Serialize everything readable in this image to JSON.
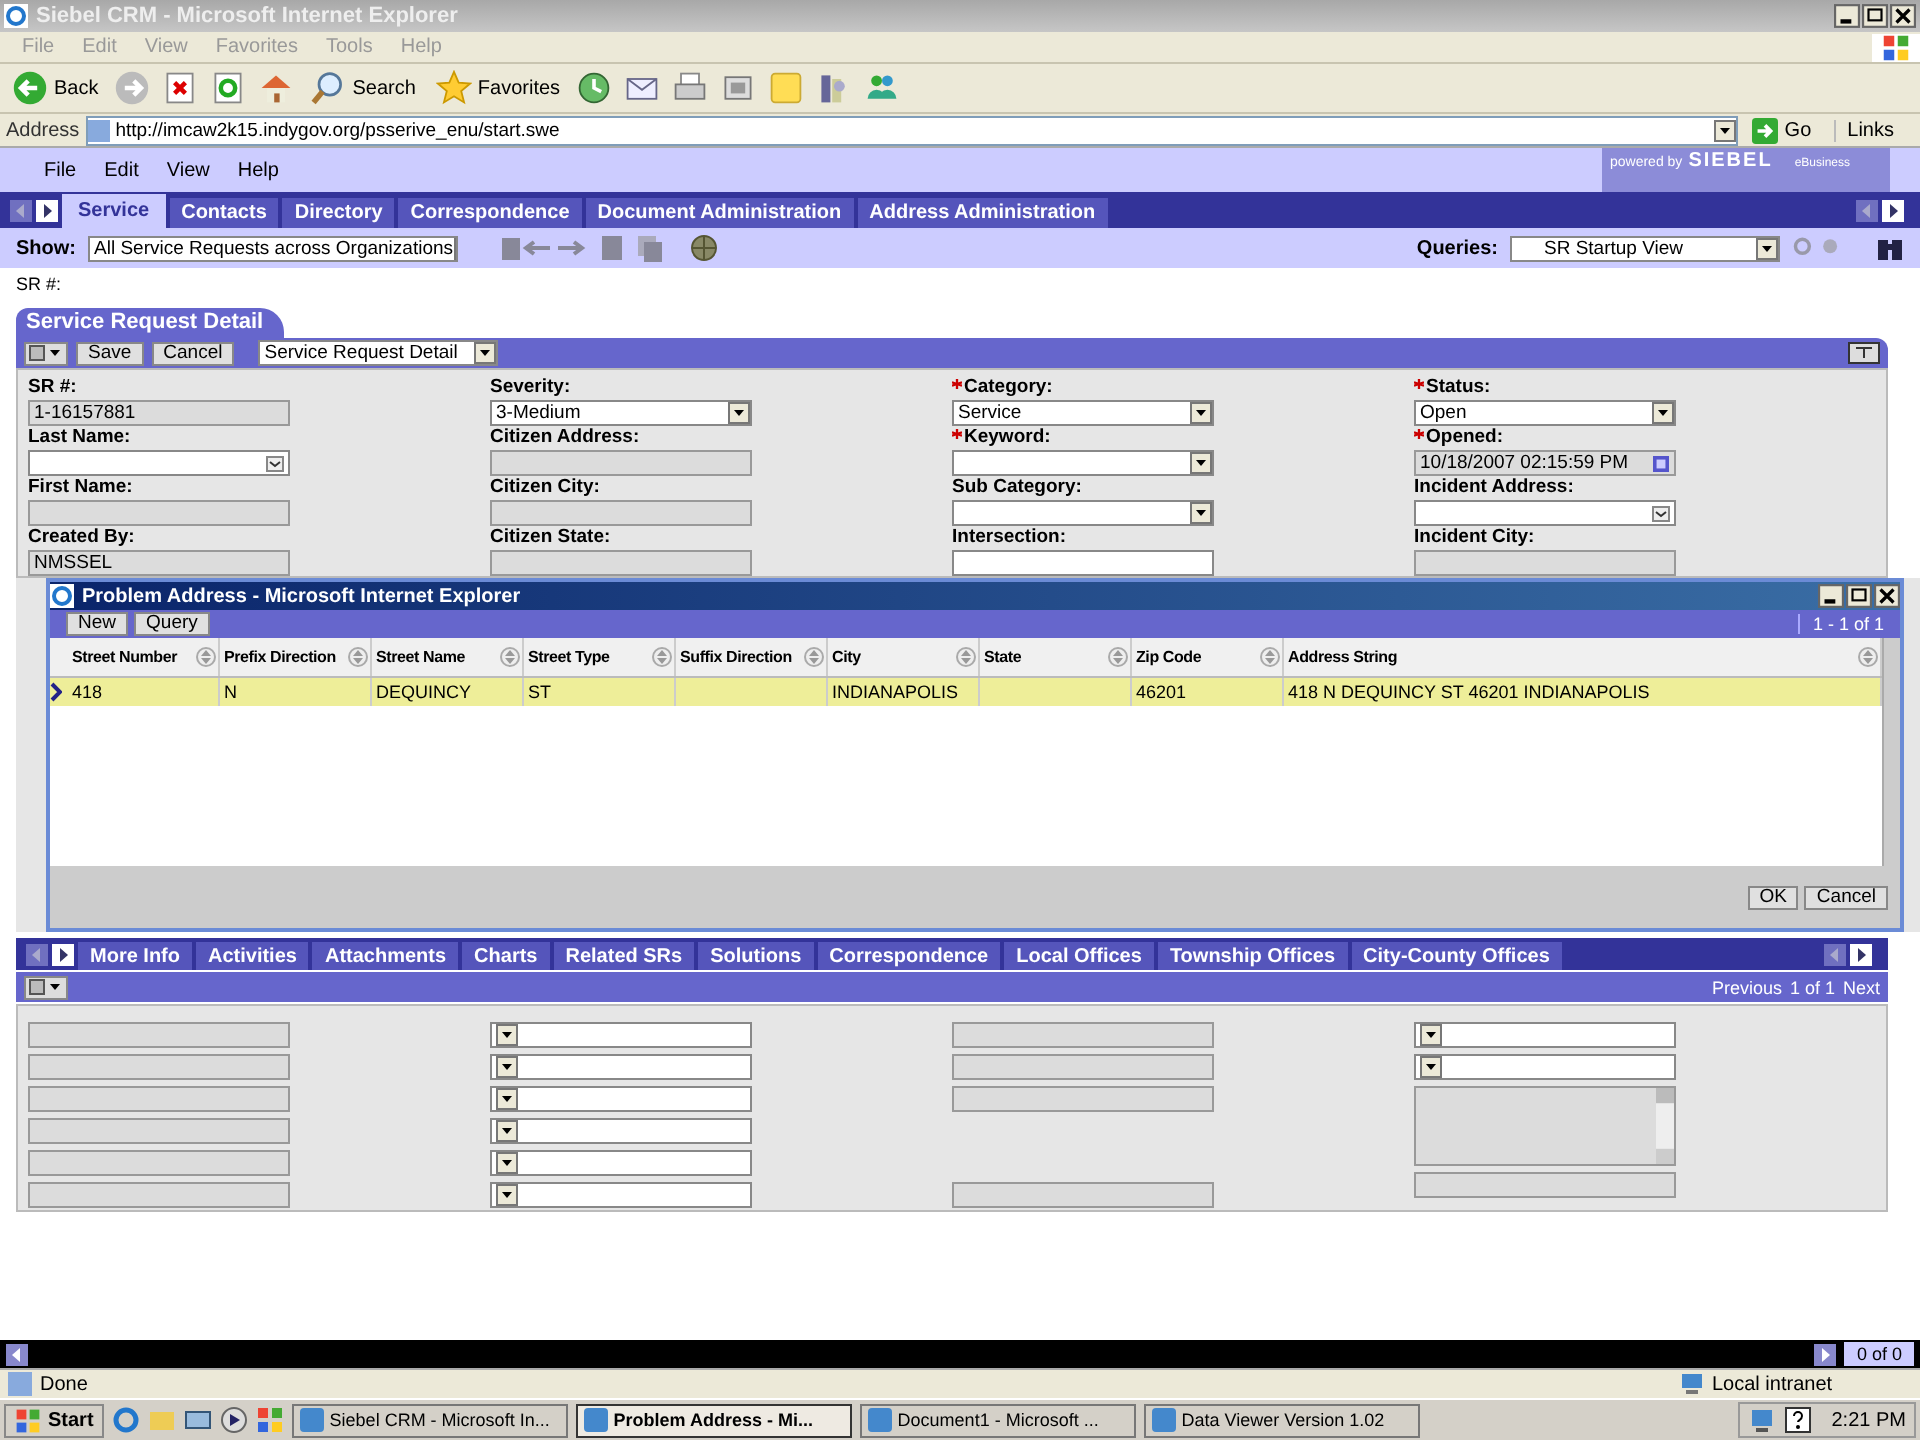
{
  "browser": {
    "title": "Siebel CRM - Microsoft Internet Explorer",
    "menu": [
      "File",
      "Edit",
      "View",
      "Favorites",
      "Tools",
      "Help"
    ],
    "toolbar": [
      {
        "kind": "back",
        "label": "Back"
      },
      {
        "kind": "forward"
      },
      {
        "kind": "stop"
      },
      {
        "kind": "refresh"
      },
      {
        "kind": "home"
      },
      {
        "kind": "search",
        "label": "Search"
      },
      {
        "kind": "favorites",
        "label": "Favorites"
      },
      {
        "kind": "history"
      },
      {
        "kind": "mail"
      },
      {
        "kind": "print"
      },
      {
        "kind": "edit"
      },
      {
        "kind": "note"
      },
      {
        "kind": "research"
      },
      {
        "kind": "messenger"
      }
    ],
    "address_label": "Address",
    "address": "http://imcaw2k15.indygov.org/psserive_enu/start.swe",
    "go": "Go",
    "links": "Links"
  },
  "app": {
    "menu": [
      "File",
      "Edit",
      "View",
      "Help"
    ],
    "logo": {
      "prefix": "powered by",
      "brand": "SIEBEL",
      "tagline": "eBusiness"
    },
    "tabs": [
      {
        "label": "Service",
        "selected": true
      },
      {
        "label": "Contacts",
        "selected": false
      },
      {
        "label": "Directory",
        "selected": false
      },
      {
        "label": "Correspondence",
        "selected": false
      },
      {
        "label": "Document Administration",
        "selected": false
      },
      {
        "label": "Address Administration",
        "selected": false
      }
    ],
    "show_label": "Show:",
    "show_value": "All Service Requests across Organizations",
    "queries_label": "Queries:",
    "queries_value": "SR Startup View",
    "sr_line": "SR #:"
  },
  "detail": {
    "title": "Service Request Detail",
    "buttons": [
      "Save",
      "Cancel"
    ],
    "view": "Service Request Detail",
    "columns": [
      {
        "fields": [
          {
            "label": "SR #:",
            "kind": "readonly",
            "value": "1-16157881",
            "required": false
          },
          {
            "label": "Last Name:",
            "kind": "pick",
            "required": false
          },
          {
            "label": "First Name:",
            "kind": "readonly",
            "required": false
          },
          {
            "label": "Created By:",
            "kind": "readonly",
            "value": "NMSSEL",
            "required": false
          }
        ]
      },
      {
        "fields": [
          {
            "label": "Severity:",
            "kind": "select",
            "value": "3-Medium",
            "required": false
          },
          {
            "label": "Citizen Address:",
            "kind": "readonly",
            "required": false
          },
          {
            "label": "Citizen City:",
            "kind": "readonly",
            "required": false
          },
          {
            "label": "Citizen State:",
            "kind": "readonly",
            "required": false
          }
        ]
      },
      {
        "fields": [
          {
            "label": "Category:",
            "kind": "select",
            "value": "Service",
            "required": true
          },
          {
            "label": "Keyword:",
            "kind": "select",
            "required": true
          },
          {
            "label": "Sub Category:",
            "kind": "select",
            "required": false
          },
          {
            "label": "Intersection:",
            "kind": "text",
            "required": false
          }
        ]
      },
      {
        "fields": [
          {
            "label": "Status:",
            "kind": "select",
            "value": "Open",
            "required": true
          },
          {
            "label": "Opened:",
            "kind": "date",
            "value": "10/18/2007 02:15:59 PM",
            "required": true
          },
          {
            "label": "Incident Address:",
            "kind": "pick",
            "required": false
          },
          {
            "label": "Incident City:",
            "kind": "readonly",
            "required": false
          }
        ]
      }
    ]
  },
  "popup": {
    "title": "Problem Address - Microsoft Internet Explorer",
    "buttons": [
      "New",
      "Query"
    ],
    "count": "1 - 1 of 1",
    "columns": [
      "Street Number",
      "Prefix Direction",
      "Street Name",
      "Street Type",
      "Suffix Direction",
      "City",
      "State",
      "Zip Code",
      "Address String"
    ],
    "rows": [
      {
        "selected": true,
        "cells": [
          "418",
          "N",
          "DEQUINCY",
          "ST",
          "",
          "INDIANAPOLIS",
          "",
          "46201",
          "418 N DEQUINCY ST  46201 INDIANAPOLIS"
        ]
      }
    ],
    "footer_buttons": [
      "OK",
      "Cancel"
    ]
  },
  "lower": {
    "tabs": [
      "More Info",
      "Activities",
      "Attachments",
      "Charts",
      "Related SRs",
      "Solutions",
      "Correspondence",
      "Local Offices",
      "Township Offices",
      "City-County Offices"
    ],
    "pager": {
      "previous": "Previous",
      "position": "1 of 1",
      "next": "Next"
    },
    "columns": [
      [
        {
          "kind": "readonly"
        },
        {
          "kind": "readonly"
        },
        {
          "kind": "readonly"
        },
        {
          "kind": "readonly"
        },
        {
          "kind": "readonly"
        },
        {
          "kind": "readonly"
        }
      ],
      [
        {
          "kind": "select"
        },
        {
          "kind": "select"
        },
        {
          "kind": "select"
        },
        {
          "kind": "select"
        },
        {
          "kind": "select"
        },
        {
          "kind": "select"
        }
      ],
      [
        {
          "kind": "readonly"
        },
        {
          "kind": "readonly"
        },
        {
          "kind": "readonly"
        },
        {
          "kind": "empty"
        },
        {
          "kind": "readonly"
        }
      ],
      [
        {
          "kind": "select"
        },
        {
          "kind": "select"
        },
        {
          "kind": "textarea"
        },
        {
          "kind": "readonly"
        }
      ]
    ]
  },
  "record_count": "0 of 0",
  "status_bar": {
    "text": "Done",
    "zone": "Local intranet"
  },
  "taskbar": {
    "start": "Start",
    "tasks": [
      {
        "label": "Siebel CRM - Microsoft In...",
        "selected": false
      },
      {
        "label": "Problem Address - Mi...",
        "selected": true
      },
      {
        "label": "Document1 - Microsoft ...",
        "selected": false
      },
      {
        "label": "Data Viewer Version 1.02",
        "selected": false
      }
    ],
    "clock": "2:21 PM"
  }
}
